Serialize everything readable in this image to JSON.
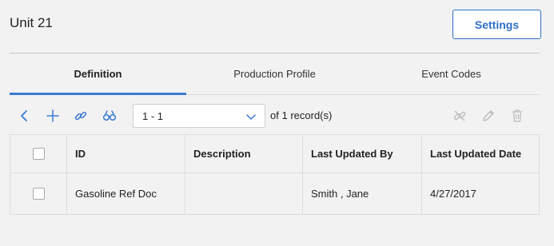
{
  "header": {
    "title": "Unit 21",
    "settings_label": "Settings"
  },
  "tabs": [
    {
      "label": "Definition",
      "active": true
    },
    {
      "label": "Production Profile",
      "active": false
    },
    {
      "label": "Event Codes",
      "active": false
    }
  ],
  "toolbar": {
    "icons": [
      "back-icon",
      "add-icon",
      "link-icon",
      "binoculars-icon",
      "unlink-icon",
      "edit-icon",
      "delete-icon"
    ],
    "record_select_value": "1 - 1",
    "of_label": "of",
    "record_count": "1",
    "records_label": "record(s)"
  },
  "table": {
    "columns": [
      "",
      "ID",
      "Description",
      "Last Updated By",
      "Last Updated Date"
    ],
    "rows": [
      {
        "id": "Gasoline Ref Doc",
        "description": "",
        "last_updated_by": "Smith , Jane",
        "last_updated_date": "4/27/2017"
      }
    ]
  },
  "colors": {
    "accent": "#3a7bd5",
    "button_text": "#2f6fc6",
    "disabled_icon": "#bdbdbd",
    "background": "#f2f2f2"
  }
}
